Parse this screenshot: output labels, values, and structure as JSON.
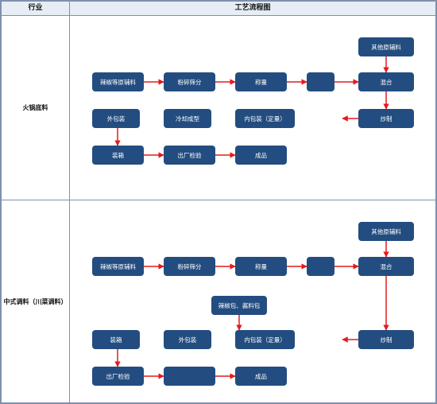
{
  "headers": {
    "industry": "行业",
    "flowchart": "工艺流程图"
  },
  "rows": [
    {
      "label": "火锅底料",
      "boxes": [
        {
          "id": "b0",
          "text": "其他原辅料"
        },
        {
          "id": "b1",
          "text": "辣椒等原辅料"
        },
        {
          "id": "b2",
          "text": "粉碎筛分"
        },
        {
          "id": "b3",
          "text": "称量"
        },
        {
          "id": "b4",
          "text": "混合"
        },
        {
          "id": "b5",
          "text": "外包装"
        },
        {
          "id": "b6",
          "text": "冷却成型"
        },
        {
          "id": "b7",
          "text": "内包装（定量）"
        },
        {
          "id": "b8",
          "text": "炒制"
        },
        {
          "id": "b9",
          "text": "装箱"
        },
        {
          "id": "b10",
          "text": "出厂检验"
        },
        {
          "id": "b11",
          "text": "成品"
        }
      ]
    },
    {
      "label": "中式调料（川菜调料）",
      "boxes": [
        {
          "id": "c0",
          "text": "其他原辅料"
        },
        {
          "id": "c1",
          "text": "辣椒等原辅料"
        },
        {
          "id": "c2",
          "text": "粉碎筛分"
        },
        {
          "id": "c3",
          "text": "称量"
        },
        {
          "id": "c4",
          "text": "混合"
        },
        {
          "id": "c5",
          "text": "辣椒包、酱料包"
        },
        {
          "id": "c6",
          "text": "装箱"
        },
        {
          "id": "c7",
          "text": "外包装"
        },
        {
          "id": "c8",
          "text": "内包装（定量）"
        },
        {
          "id": "c9",
          "text": "炒制"
        },
        {
          "id": "c10",
          "text": "出厂检验"
        },
        {
          "id": "c11",
          "text": "成品"
        }
      ]
    }
  ]
}
